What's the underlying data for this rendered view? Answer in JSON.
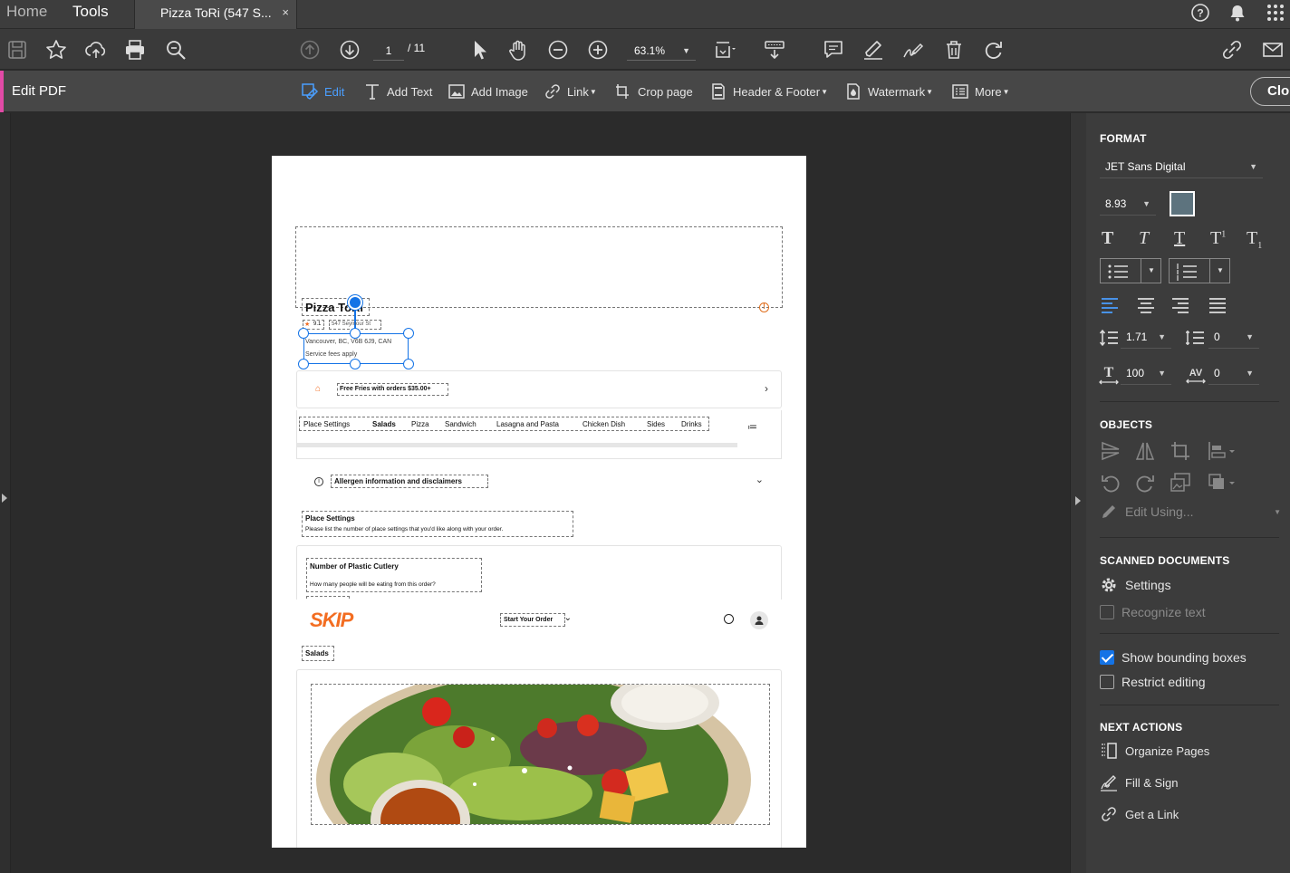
{
  "tabbar": {
    "home": "Home",
    "tools": "Tools",
    "document_tab": "Pizza ToRi (547 S...",
    "close": "×"
  },
  "toolbar": {
    "page_current": "1",
    "page_total": "/ 11",
    "zoom": "63.1%"
  },
  "editbar": {
    "title": "Edit PDF",
    "edit": "Edit",
    "add_text": "Add Text",
    "add_image": "Add Image",
    "link": "Link",
    "crop": "Crop page",
    "header_footer": "Header & Footer",
    "watermark": "Watermark",
    "more": "More",
    "close": "Clo"
  },
  "document": {
    "restaurant_name": "Pizza ToRi",
    "rating": "9.1",
    "address_short": "547 Seymour St",
    "address_full": "Vancouver, BC, V6B 6J9, CAN",
    "service_fees": "Service fees apply",
    "promo": "Free Fries with orders $35.00+",
    "menu_tabs": [
      "Place Settings",
      "Salads",
      "Pizza",
      "Sandwich",
      "Lasagna and Pasta",
      "Chicken Dish",
      "Sides",
      "Drinks"
    ],
    "allergen": "Allergen information and disclaimers",
    "place_settings_title": "Place Settings",
    "place_settings_desc": "Please list the number of place settings that you'd like along with your order.",
    "cutlery_title": "Number of Plastic Cutlery",
    "cutlery_desc": "How many people will be eating from this order?",
    "brand": "SKIP",
    "start_order": "Start Your Order",
    "salads_heading": "Salads"
  },
  "panel": {
    "format": "FORMAT",
    "font": "JET Sans Digital",
    "font_size": "8.93",
    "line_spacing": "1.71",
    "para_spacing": "0",
    "h_scale": "100",
    "char_spacing": "0",
    "objects": "OBJECTS",
    "edit_using": "Edit Using...",
    "scanned": "SCANNED DOCUMENTS",
    "settings": "Settings",
    "recognize": "Recognize text",
    "show_bbox": "Show bounding boxes",
    "restrict": "Restrict editing",
    "next_actions": "NEXT ACTIONS",
    "organize": "Organize Pages",
    "fill_sign": "Fill & Sign",
    "get_link": "Get a Link"
  },
  "colors": {
    "accent": "#1473e6",
    "edit_accent": "#e14aa6",
    "skip_orange": "#f36d21",
    "text_color_swatch": "#5d737e"
  }
}
